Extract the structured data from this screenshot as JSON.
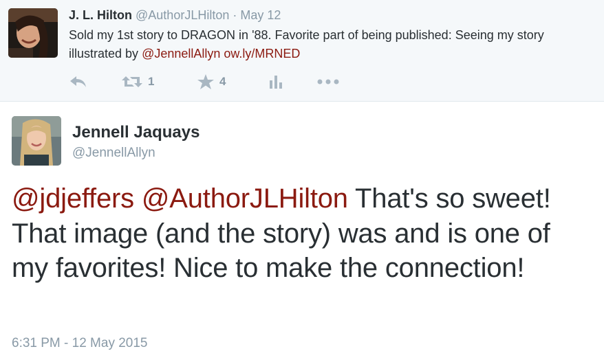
{
  "parent_tweet": {
    "author_name": "J. L. Hilton",
    "author_handle": "@AuthorJLHilton",
    "separator": "·",
    "date": "May 12",
    "text_plain": "Sold my 1st story to DRAGON in '88. Favorite part of being published: Seeing my story illustrated by ",
    "mention": "@JennellAllyn",
    "link": "ow.ly/MRNED",
    "actions": {
      "reply_icon": "reply-icon",
      "retweet_icon": "retweet-icon",
      "retweet_count": "1",
      "favorite_icon": "star-icon",
      "favorite_count": "4",
      "analytics_icon": "bar-chart-icon",
      "more_icon": "more-dots-icon"
    }
  },
  "main_tweet": {
    "author_name": "Jennell Jaquays",
    "author_handle": "@JennellAllyn",
    "mention_1": "@jdjeffers",
    "mention_2": "@AuthorJLHilton",
    "text_plain": " That's so sweet! That image (and the story) was and is one of my favorites! Nice to make the connection!",
    "timestamp": "6:31 PM - 12 May 2015"
  },
  "colors": {
    "link": "#8b1a10",
    "secondary_text": "#8899a6",
    "primary_text": "#292f33",
    "parent_background": "#f5f8fa"
  }
}
